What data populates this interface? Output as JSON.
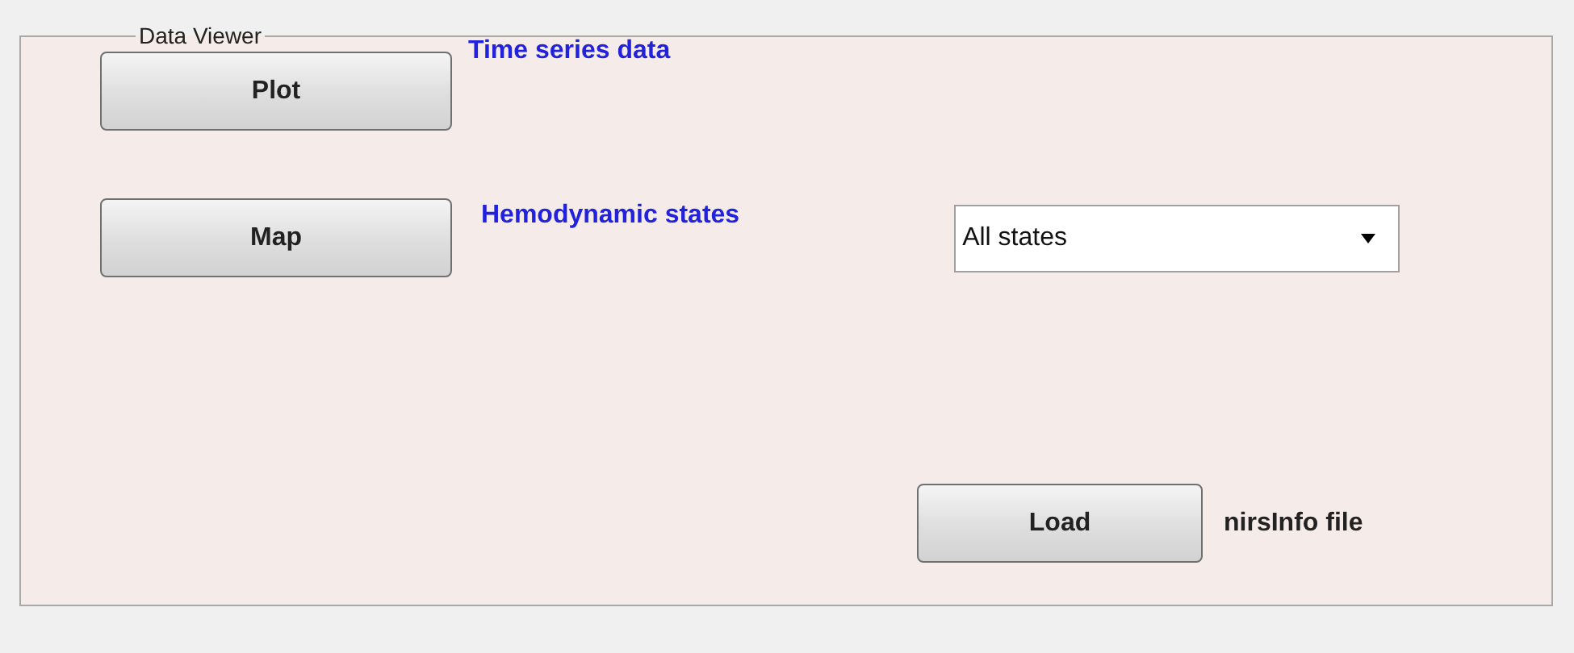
{
  "panel": {
    "title": "Data Viewer"
  },
  "plot": {
    "button": "Plot",
    "label": "Time series data"
  },
  "map": {
    "button": "Map",
    "label": "Hemodynamic states",
    "dropdown": {
      "value": "All states"
    }
  },
  "load": {
    "button": "Load",
    "label": "nirsInfo file"
  }
}
